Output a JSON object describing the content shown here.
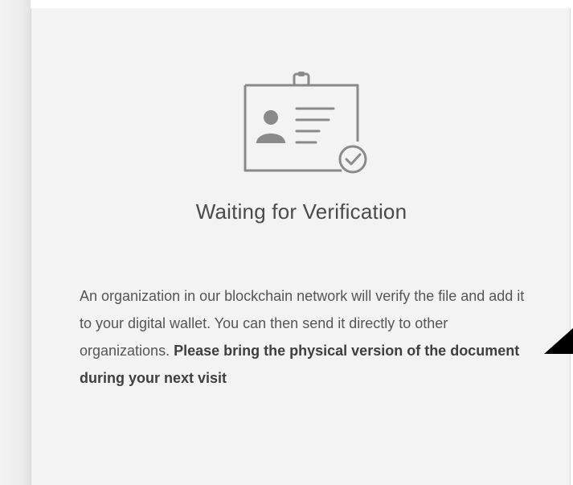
{
  "panel": {
    "title": "Waiting for Verification",
    "description": "An organization in our blockchain network will verify the file and add it to your digital wallet. You can then send it directly to other organizations.",
    "emphasis": "Please bring the physical version of the document during your next visit"
  },
  "icons": {
    "status_icon": "id-card-verified-icon",
    "pointer": "cursor-pointer-icon"
  },
  "colors": {
    "panel_background": "#f3f3f3",
    "icon_stroke": "#8a8a8a",
    "title_text": "#4a4a4a",
    "body_text": "#555555"
  }
}
